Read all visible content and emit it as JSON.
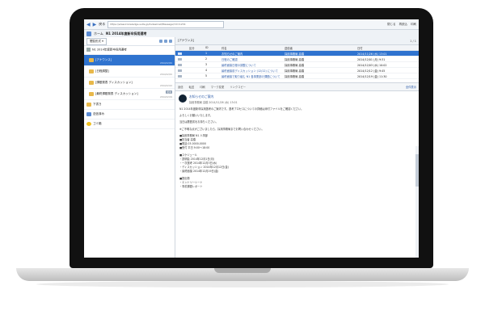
{
  "browser": {
    "back_label": "戻る",
    "url": "https://www.knowledge-suite.jp/dsdesknet/Message/?id=1234",
    "top_links": [
      "閉じる",
      "再読込",
      "印刷"
    ],
    "home_label": "ホーム",
    "page_title": "N1 2014年度新卒採用選考"
  },
  "left_panel": {
    "dropdown_label": "閲覧形式",
    "root_label": "N1 2014年度新卒採用選考",
    "folders": [
      {
        "label": "[アナウンス]",
        "date": "2014/12/01",
        "selected": true,
        "badge": ""
      },
      {
        "label": "[日程調整]",
        "date": "2014/12/01",
        "selected": false,
        "badge": ""
      },
      {
        "label": "[課題発表 ディスカッション]",
        "date": "2014/12/12",
        "selected": false,
        "badge": ""
      },
      {
        "label": "[最終課題発表 ディスカッション]",
        "date": "2014/12/19",
        "selected": false,
        "badge": "更新"
      }
    ],
    "items": [
      {
        "label": "下書き",
        "icon": "draft-folder-icon"
      },
      {
        "label": "送信済み",
        "icon": "sent-folder-icon"
      },
      {
        "label": "ゴミ箱",
        "icon": "trash-icon"
      }
    ]
  },
  "list": {
    "title": "[アナウンス]",
    "pager": "1 / 1",
    "columns": [
      "",
      "区分",
      "ID",
      "件名",
      "送信者",
      "日付"
    ],
    "rows": [
      {
        "type": "",
        "id": "1",
        "subject": "お知らせのご案内",
        "sender": "採用事務局 高橋",
        "date": "2014/11/26 (水) 13:01",
        "highlight": true
      },
      {
        "type": "",
        "id": "2",
        "subject": "日程のご確認",
        "sender": "採用事務局 高橋",
        "date": "2014/12/01 (月) 9:31",
        "highlight": false
      },
      {
        "type": "",
        "id": "3",
        "subject": "最終面接日程の調整について",
        "sender": "採用事務局 高橋",
        "date": "2014/12/03 (水) 10:02",
        "highlight": false
      },
      {
        "type": "",
        "id": "4",
        "subject": "最終面接前ディスカッション (12/12) について",
        "sender": "採用事務局 高橋",
        "date": "2014/12/12 (金) 9:45",
        "highlight": false
      },
      {
        "type": "",
        "id": "5",
        "subject": "最終面接で取り組む N1 各事業部の課題について",
        "sender": "採用事務局 高橋",
        "date": "2014/12/19 (金) 11:30",
        "highlight": false
      }
    ]
  },
  "actions": [
    "返信",
    "転送",
    "印刷",
    "マーク変更",
    "リンクコピー"
  ],
  "actions_right": "全件表示",
  "message": {
    "subject": "お知らせのご案内",
    "meta": "採用事務局 高橋 2014/11/26 (水) 13:01",
    "body": [
      "N1 2014年度新卒採用選考のご案内です。選考プロセスについての詳細は添付ファイルをご確認ください。",
      "よろしくお願いいたします。",
      "当日は履歴書をお持ちください。",
      "※ご不明な点がございましたら、採用事務局までお問い合わせください。",
      "■採用事務局 N1 人事部\n■担当者 高橋\n■電話 03-0000-0000\n■受付 平日 9:00〜18:00",
      "■スケジュール\n・説明会 2014年12月1日(月)\n・一次選考 2014年12月3日(水)\n・ディスカッション 2014年12月12日(金)\n・最終面接 2014年12月19日(金)",
      "■提出物\n・エントリーシート\n・事前課題レポート"
    ]
  },
  "colors": {
    "accent": "#2f73cf",
    "link": "#2a5aa8",
    "bezel": "#111111"
  }
}
